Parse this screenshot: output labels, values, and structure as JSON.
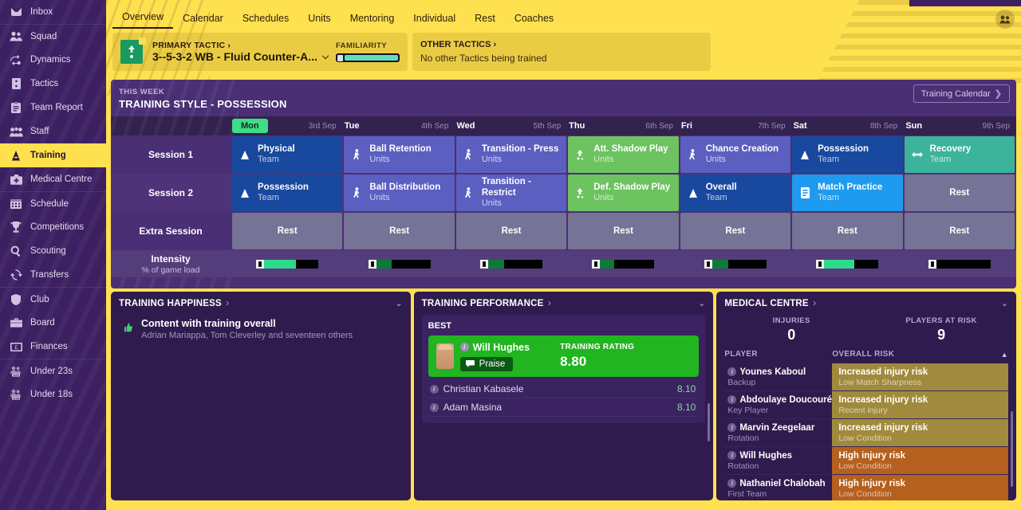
{
  "sidebar": {
    "items": [
      {
        "label": "Inbox",
        "icon": "inbox-icon",
        "group": 0
      },
      {
        "label": "Squad",
        "icon": "squad-icon",
        "group": 1
      },
      {
        "label": "Dynamics",
        "icon": "dynamics-icon",
        "group": 1
      },
      {
        "label": "Tactics",
        "icon": "tactics-icon",
        "group": 1
      },
      {
        "label": "Team Report",
        "icon": "team-report-icon",
        "group": 1
      },
      {
        "label": "Staff",
        "icon": "staff-icon",
        "group": 1
      },
      {
        "label": "Training",
        "icon": "training-icon",
        "group": 1,
        "active": true
      },
      {
        "label": "Medical Centre",
        "icon": "medical-icon",
        "group": 1
      },
      {
        "label": "Schedule",
        "icon": "calendar-icon",
        "group": 2
      },
      {
        "label": "Competitions",
        "icon": "trophy-icon",
        "group": 2
      },
      {
        "label": "Scouting",
        "icon": "search-icon",
        "group": 2
      },
      {
        "label": "Transfers",
        "icon": "transfers-icon",
        "group": 2
      },
      {
        "label": "Club",
        "icon": "shield-icon",
        "group": 3
      },
      {
        "label": "Board",
        "icon": "briefcase-icon",
        "group": 3
      },
      {
        "label": "Finances",
        "icon": "banknote-icon",
        "group": 3
      },
      {
        "label": "Under 23s",
        "icon": "u23-icon",
        "group": 4
      },
      {
        "label": "Under 18s",
        "icon": "u18-icon",
        "group": 4
      }
    ]
  },
  "tabs": [
    {
      "label": "Overview",
      "active": true
    },
    {
      "label": "Calendar",
      "active": false
    },
    {
      "label": "Schedules",
      "active": false
    },
    {
      "label": "Units",
      "active": false
    },
    {
      "label": "Mentoring",
      "active": false
    },
    {
      "label": "Individual",
      "active": false
    },
    {
      "label": "Rest",
      "active": false
    },
    {
      "label": "Coaches",
      "active": false
    }
  ],
  "tactic": {
    "primary_kicker": "PRIMARY TACTIC",
    "primary_arrow": "›",
    "primary_name": "3--5-3-2 WB - Fluid Counter-A...",
    "dropdown_caret": "⌵",
    "familiarity_label": "FAMILIARITY",
    "familiarity_percent": 88,
    "other_kicker": "OTHER TACTICS",
    "other_arrow": "›",
    "other_text": "No other Tactics being trained"
  },
  "training": {
    "kicker": "THIS WEEK",
    "title": "TRAINING STYLE - POSSESSION",
    "calendar_button": "Training Calendar",
    "calendar_chevron": "❯",
    "days": [
      {
        "name": "Mon",
        "date": "3rd Sep",
        "today": true
      },
      {
        "name": "Tue",
        "date": "4th Sep",
        "today": false
      },
      {
        "name": "Wed",
        "date": "5th Sep",
        "today": false
      },
      {
        "name": "Thu",
        "date": "6th Sep",
        "today": false
      },
      {
        "name": "Fri",
        "date": "7th Sep",
        "today": false
      },
      {
        "name": "Sat",
        "date": "8th Sep",
        "today": false
      },
      {
        "name": "Sun",
        "date": "9th Sep",
        "today": false
      }
    ],
    "rows": [
      {
        "label": "Session 1",
        "cells": [
          {
            "name": "Physical",
            "unit": "Team",
            "icon": "cone-icon",
            "color": "#18499e"
          },
          {
            "name": "Ball Retention",
            "unit": "Units",
            "icon": "player-icon",
            "color": "#5b5fc0"
          },
          {
            "name": "Transition - Press",
            "unit": "Units",
            "icon": "player-icon",
            "color": "#5b5fc0"
          },
          {
            "name": "Att. Shadow Play",
            "unit": "Units",
            "icon": "tactic-icon",
            "color": "#6cc35f"
          },
          {
            "name": "Chance Creation",
            "unit": "Units",
            "icon": "player-icon",
            "color": "#5b5fc0"
          },
          {
            "name": "Possession",
            "unit": "Team",
            "icon": "cone-icon",
            "color": "#18499e"
          },
          {
            "name": "Recovery",
            "unit": "Team",
            "icon": "recovery-icon",
            "color": "#3cb39b"
          }
        ]
      },
      {
        "label": "Session 2",
        "cells": [
          {
            "name": "Possession",
            "unit": "Team",
            "icon": "cone-icon",
            "color": "#18499e"
          },
          {
            "name": "Ball Distribution",
            "unit": "Units",
            "icon": "player-icon",
            "color": "#5b5fc0"
          },
          {
            "name": "Transition - Restrict",
            "unit": "Units",
            "icon": "player-icon",
            "color": "#5b5fc0"
          },
          {
            "name": "Def. Shadow Play",
            "unit": "Units",
            "icon": "tactic-icon",
            "color": "#6cc35f"
          },
          {
            "name": "Overall",
            "unit": "Team",
            "icon": "cone-icon",
            "color": "#18499e"
          },
          {
            "name": "Match Practice",
            "unit": "Team",
            "icon": "match-icon",
            "color": "#1e9aee"
          },
          {
            "name": "Rest",
            "unit": "",
            "icon": "",
            "color": "#757396",
            "rest": true
          }
        ]
      },
      {
        "label": "Extra Session",
        "cells": [
          {
            "name": "Rest",
            "unit": "",
            "icon": "",
            "color": "#757396",
            "rest": true
          },
          {
            "name": "Rest",
            "unit": "",
            "icon": "",
            "color": "#757396",
            "rest": true
          },
          {
            "name": "Rest",
            "unit": "",
            "icon": "",
            "color": "#757396",
            "rest": true
          },
          {
            "name": "Rest",
            "unit": "",
            "icon": "",
            "color": "#757396",
            "rest": true
          },
          {
            "name": "Rest",
            "unit": "",
            "icon": "",
            "color": "#757396",
            "rest": true
          },
          {
            "name": "Rest",
            "unit": "",
            "icon": "",
            "color": "#757396",
            "rest": true
          },
          {
            "name": "Rest",
            "unit": "",
            "icon": "",
            "color": "#757396",
            "rest": true
          }
        ]
      }
    ],
    "intensity": {
      "label": "Intensity",
      "sublabel": "% of game load",
      "bars": [
        {
          "percent": 58,
          "color": "#2fd98c"
        },
        {
          "percent": 28,
          "color": "#0f7a38"
        },
        {
          "percent": 30,
          "color": "#0f7a38"
        },
        {
          "percent": 26,
          "color": "#0f7a38"
        },
        {
          "percent": 30,
          "color": "#0f7a38"
        },
        {
          "percent": 55,
          "color": "#2fd98c"
        },
        {
          "percent": 0,
          "color": "#0f7a38"
        }
      ]
    }
  },
  "happiness": {
    "title": "TRAINING HAPPINESS",
    "arrow": "›",
    "caret": "⌄",
    "thumb_icon": "thumbs-up-icon",
    "headline": "Content with training overall",
    "detail": "Adrian Mariappa, Tom Cleverley and seventeen others"
  },
  "performance": {
    "title": "TRAINING PERFORMANCE",
    "arrow": "›",
    "caret": "⌄",
    "best_label": "BEST",
    "best": {
      "name": "Will Hughes",
      "praise_label": "Praise",
      "praise_icon": "speech-bubble-icon",
      "rating_label": "TRAINING RATING",
      "rating": "8.80"
    },
    "others": [
      {
        "name": "Christian Kabasele",
        "rating": "8.10"
      },
      {
        "name": "Adam Masina",
        "rating": "8.10"
      }
    ]
  },
  "medical": {
    "title": "MEDICAL CENTRE",
    "arrow": "›",
    "caret": "⌄",
    "stats": [
      {
        "label": "INJURIES",
        "value": "0"
      },
      {
        "label": "PLAYERS AT RISK",
        "value": "9"
      }
    ],
    "columns": {
      "player": "PLAYER",
      "risk": "OVERALL RISK",
      "sort": "▲"
    },
    "rows": [
      {
        "player": "Younes Kaboul",
        "role": "Backup",
        "risk": "Increased injury risk",
        "reason": "Low Match Sharpness",
        "color": "#a08a3d"
      },
      {
        "player": "Abdoulaye Doucouré",
        "role": "Key Player",
        "risk": "Increased injury risk",
        "reason": "Recent injury",
        "color": "#a08a3d"
      },
      {
        "player": "Marvin Zeegelaar",
        "role": "Rotation",
        "risk": "Increased injury risk",
        "reason": "Low Condition",
        "color": "#a08a3d"
      },
      {
        "player": "Will Hughes",
        "role": "Rotation",
        "risk": "High injury risk",
        "reason": "Low Condition",
        "color": "#b5601e"
      },
      {
        "player": "Nathaniel Chalobah",
        "role": "First Team",
        "risk": "High injury risk",
        "reason": "Low Condition",
        "color": "#b5601e"
      }
    ]
  },
  "header": {
    "avatar_icon": "people-icon"
  },
  "colors": {
    "accent": "#ffe14f",
    "purple_dark": "#2f1b4d",
    "purple_mid": "#4a2f74",
    "green": "#21b521",
    "today_green": "#3fdd87"
  }
}
